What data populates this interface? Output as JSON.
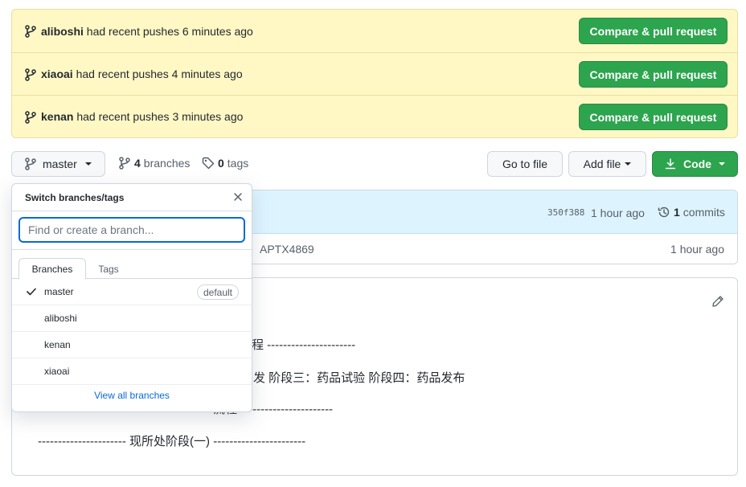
{
  "recent_pushes": [
    {
      "user": "aliboshi",
      "text": "had recent pushes 6 minutes ago",
      "button": "Compare & pull request"
    },
    {
      "user": "xiaoai",
      "text": "had recent pushes 4 minutes ago",
      "button": "Compare & pull request"
    },
    {
      "user": "kenan",
      "text": "had recent pushes 3 minutes ago",
      "button": "Compare & pull request"
    }
  ],
  "toolbar": {
    "branch": "master",
    "branches_count": "4",
    "branches_label": "branches",
    "tags_count": "0",
    "tags_label": "tags",
    "go_to_file": "Go to file",
    "add_file": "Add file",
    "code": "Code"
  },
  "commit": {
    "hash": "350f388",
    "time": "1 hour ago",
    "commits_count": "1",
    "commits_label": "commits",
    "file_message": "APTX4869",
    "file_time": "1 hour ago"
  },
  "readme": {
    "line1": "程 ----------------------",
    "line2": "发 阶段三：药品试验 阶段四：药品发布",
    "line3": "流程 -----------------------",
    "line4": "---------------------- 现所处阶段(一) -----------------------"
  },
  "dropdown": {
    "title": "Switch branches/tags",
    "search_placeholder": "Find or create a branch...",
    "tabs": {
      "branches": "Branches",
      "tags": "Tags"
    },
    "items": [
      {
        "name": "master",
        "selected": true,
        "badge": "default"
      },
      {
        "name": "aliboshi"
      },
      {
        "name": "kenan"
      },
      {
        "name": "xiaoai"
      }
    ],
    "footer": "View all branches"
  },
  "icons": [
    "git-branch-icon",
    "tag-icon",
    "download-icon",
    "history-icon",
    "pencil-icon",
    "close-icon",
    "check-icon"
  ],
  "colors": {
    "banner_bg": "#fff8c5",
    "primary_green": "#2da44e",
    "link_blue": "#0969da",
    "commit_bg": "#ddf4ff"
  }
}
